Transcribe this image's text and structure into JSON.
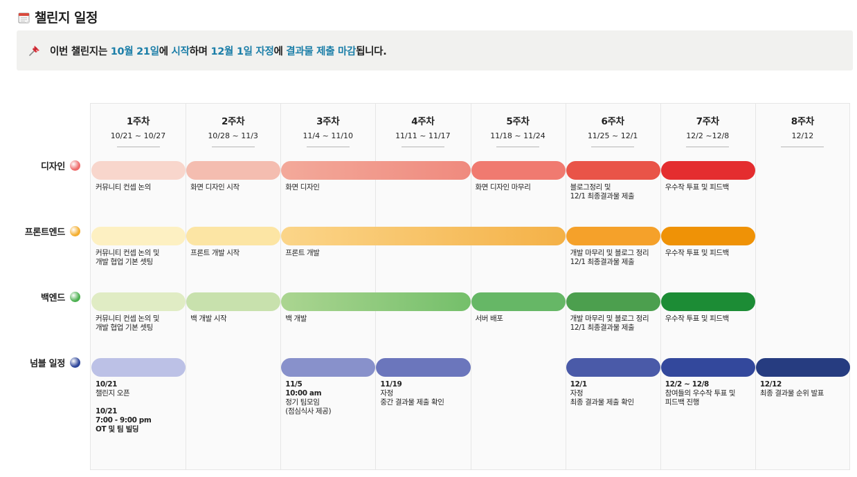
{
  "page": {
    "title": "챌린지 일정",
    "title_icon": "calendar-icon",
    "callout": {
      "icon": "pushpin-icon",
      "parts": [
        {
          "text": "이번 챌린지는 ",
          "hl": false
        },
        {
          "text": "10월 21일",
          "hl": true
        },
        {
          "text": "에 ",
          "hl": false
        },
        {
          "text": "시작",
          "hl": true
        },
        {
          "text": "하며 ",
          "hl": false
        },
        {
          "text": "12월 1일 자정",
          "hl": true
        },
        {
          "text": "에 ",
          "hl": false
        },
        {
          "text": "결과물 제출 마감",
          "hl": true
        },
        {
          "text": "됩니다.",
          "hl": false
        }
      ]
    }
  },
  "weeks": [
    {
      "label": "1주차",
      "range": "10/21 ~ 10/27"
    },
    {
      "label": "2주차",
      "range": "10/28 ~ 11/3"
    },
    {
      "label": "3주차",
      "range": "11/4 ~ 11/10"
    },
    {
      "label": "4주차",
      "range": "11/11 ~ 11/17"
    },
    {
      "label": "5주차",
      "range": "11/18 ~ 11/24"
    },
    {
      "label": "6주차",
      "range": "11/25 ~ 12/1"
    },
    {
      "label": "7주차",
      "range": "12/2 ~12/8"
    },
    {
      "label": "8주차",
      "range": "12/12"
    }
  ],
  "tracks": [
    {
      "name": "디자인",
      "dot_color": "#ee6b6b",
      "bars": [
        {
          "start": 0,
          "span": 1,
          "from": "#f8d6cc",
          "to": "#f8d6cc"
        },
        {
          "start": 1,
          "span": 1,
          "from": "#f4bdb0",
          "to": "#f4bdb0"
        },
        {
          "start": 2,
          "span": 2,
          "from": "#f3a99a",
          "to": "#ef8a7e"
        },
        {
          "start": 4,
          "span": 1,
          "from": "#f07a70",
          "to": "#f07a70"
        },
        {
          "start": 5,
          "span": 1,
          "from": "#e95448",
          "to": "#e95448"
        },
        {
          "start": 6,
          "span": 1,
          "from": "#e42d2f",
          "to": "#e42d2f"
        }
      ],
      "notes": [
        {
          "col": 0,
          "lines": [
            "커뮤니티 컨셉 논의"
          ]
        },
        {
          "col": 1,
          "lines": [
            "화면 디자인 시작"
          ]
        },
        {
          "col": 2,
          "lines": [
            "화면 디자인"
          ]
        },
        {
          "col": 4,
          "lines": [
            "화면 디자인 마무리"
          ]
        },
        {
          "col": 5,
          "lines": [
            "블로그정리 및",
            "12/1 최종결과물 제출"
          ]
        },
        {
          "col": 6,
          "lines": [
            "우수작 투표 및 피드백"
          ]
        }
      ]
    },
    {
      "name": "프론트엔드",
      "dot_color": "#f4ae2f",
      "bars": [
        {
          "start": 0,
          "span": 1,
          "from": "#fdf0c2",
          "to": "#fdf0c2"
        },
        {
          "start": 1,
          "span": 1,
          "from": "#fce5a4",
          "to": "#fce5a4"
        },
        {
          "start": 2,
          "span": 3,
          "from": "#fbd589",
          "to": "#f4b147"
        },
        {
          "start": 5,
          "span": 1,
          "from": "#f5a12a",
          "to": "#f5a12a"
        },
        {
          "start": 6,
          "span": 1,
          "from": "#ef9206",
          "to": "#ef9206"
        }
      ],
      "notes": [
        {
          "col": 0,
          "lines": [
            "커뮤니티 컨셉 논의 및",
            "개발 협업 기본 셋팅"
          ]
        },
        {
          "col": 1,
          "lines": [
            "프론트 개발 시작"
          ]
        },
        {
          "col": 2,
          "lines": [
            "프론트 개발"
          ]
        },
        {
          "col": 5,
          "lines": [
            "개발 마무리 및 블로그 정리",
            "12/1  최종결과물 제출"
          ]
        },
        {
          "col": 6,
          "lines": [
            "우수작 투표 및 피드백"
          ]
        }
      ]
    },
    {
      "name": "백엔드",
      "dot_color": "#4cb050",
      "bars": [
        {
          "start": 0,
          "span": 1,
          "from": "#e0ecc4",
          "to": "#e0ecc4"
        },
        {
          "start": 1,
          "span": 1,
          "from": "#c8e1ad",
          "to": "#c8e1ad"
        },
        {
          "start": 2,
          "span": 2,
          "from": "#abd591",
          "to": "#74bf6a"
        },
        {
          "start": 4,
          "span": 1,
          "from": "#66b766",
          "to": "#66b766"
        },
        {
          "start": 5,
          "span": 1,
          "from": "#4c9f4e",
          "to": "#4c9f4e"
        },
        {
          "start": 6,
          "span": 1,
          "from": "#1c8c35",
          "to": "#1c8c35"
        }
      ],
      "notes": [
        {
          "col": 0,
          "lines": [
            "커뮤니티 컨셉 논의 및",
            "개발 협업 기본 셋팅"
          ]
        },
        {
          "col": 1,
          "lines": [
            "백 개발 시작"
          ]
        },
        {
          "col": 2,
          "lines": [
            "백 개발"
          ]
        },
        {
          "col": 4,
          "lines": [
            "서버 배포"
          ]
        },
        {
          "col": 5,
          "lines": [
            "개발 마무리 및 블로그 정리",
            "12/1 최종결과물 제출"
          ]
        },
        {
          "col": 6,
          "lines": [
            "우수작 투표 및 피드백"
          ]
        }
      ]
    },
    {
      "name": "넘블 일정",
      "dot_color": "#2e469a",
      "bars": [
        {
          "start": 0,
          "span": 1,
          "from": "#bcc1e6",
          "to": "#bcc1e6"
        },
        {
          "start": 2,
          "span": 1,
          "from": "#8891cb",
          "to": "#8891cb"
        },
        {
          "start": 3,
          "span": 1,
          "from": "#6b76bc",
          "to": "#6b76bc"
        },
        {
          "start": 5,
          "span": 1,
          "from": "#4a5aa8",
          "to": "#4a5aa8"
        },
        {
          "start": 6,
          "span": 1,
          "from": "#33489c",
          "to": "#33489c"
        },
        {
          "start": 7,
          "span": 1,
          "from": "#263c80",
          "to": "#263c80"
        }
      ],
      "notes": [
        {
          "col": 0,
          "lines": [
            "10/21",
            "챌린지 오픈",
            " ",
            "10/21",
            "7:00 - 9:00 pm",
            "OT 및 팀 빌딩"
          ],
          "bold": [
            0,
            3,
            4,
            5
          ]
        },
        {
          "col": 2,
          "lines": [
            "11/5",
            "10:00 am",
            "정기 팀모임",
            "(점심식사 제공)"
          ],
          "bold": [
            0,
            1
          ]
        },
        {
          "col": 3,
          "lines": [
            "11/19",
            "자정",
            "중간 결과물 제출 확인"
          ],
          "bold": [
            0
          ]
        },
        {
          "col": 5,
          "lines": [
            "12/1",
            "자정",
            "최종 결과물 제출 확인"
          ],
          "bold": [
            0
          ]
        },
        {
          "col": 6,
          "lines": [
            "12/2 ~ 12/8",
            "참여들의 우수작 투표 및",
            "피드백 진행"
          ],
          "bold": [
            0
          ]
        },
        {
          "col": 7,
          "lines": [
            "12/12",
            "최종 결과물 순위 발표"
          ],
          "bold": [
            0
          ]
        }
      ]
    }
  ]
}
